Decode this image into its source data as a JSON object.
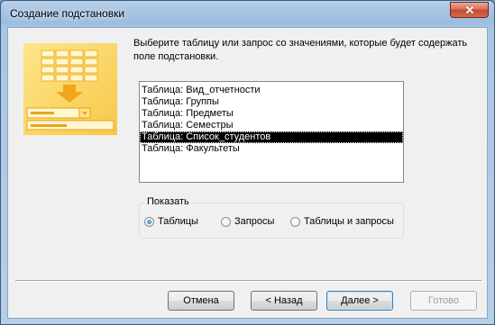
{
  "window": {
    "title": "Создание подстановки"
  },
  "prompt": {
    "text": "Выберите таблицу или запрос со значениями, которые будет содержать поле подстановки."
  },
  "list": {
    "items": [
      "Таблица: Вид_отчетности",
      "Таблица: Группы",
      "Таблица: Предметы",
      "Таблица: Семестры",
      "Таблица: Список_студентов",
      "Таблица: Факультеты"
    ],
    "selected_index": 4
  },
  "view_group": {
    "legend": "Показать",
    "options": [
      {
        "label": "Таблицы",
        "checked": true
      },
      {
        "label": "Запросы",
        "checked": false
      },
      {
        "label": "Таблицы и запросы",
        "checked": false
      }
    ]
  },
  "buttons": {
    "cancel": "Отмена",
    "back": "< Назад",
    "next": "Далее >",
    "finish": "Готово"
  },
  "colors": {
    "illustration_yellow": "#f7c23a",
    "illustration_orange": "#e8a21c"
  }
}
